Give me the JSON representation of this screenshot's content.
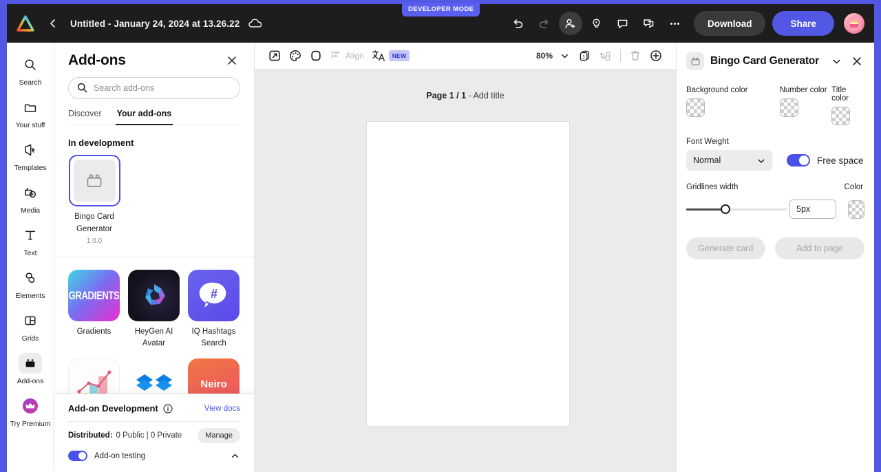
{
  "window": {
    "accent": "#5258e4"
  },
  "topbar": {
    "logo_icon": "adobe-express-logo",
    "back_icon": "chevron-left-icon",
    "document_title": "Untitled - January 24, 2024 at 13.26.22",
    "cloud_icon": "cloud-saved-icon",
    "dev_badge": "DEVELOPER MODE",
    "undo_icon": "undo-icon",
    "redo_icon": "redo-icon",
    "invite_icon": "add-collaborator-icon",
    "ideas_icon": "lightbulb-icon",
    "comment_icon": "comment-icon",
    "duplicate_icon": "copy-icon",
    "more_icon": "more-options-icon",
    "download_label": "Download",
    "share_label": "Share",
    "avatar_icon": "user-avatar"
  },
  "rail": {
    "items": [
      {
        "label": "Search",
        "icon": "search-icon",
        "active": false
      },
      {
        "label": "Your stuff",
        "icon": "folder-icon",
        "active": false
      },
      {
        "label": "Templates",
        "icon": "templates-icon",
        "active": false
      },
      {
        "label": "Media",
        "icon": "media-icon",
        "active": false
      },
      {
        "label": "Text",
        "icon": "text-icon",
        "active": false
      },
      {
        "label": "Elements",
        "icon": "elements-icon",
        "active": false
      },
      {
        "label": "Grids",
        "icon": "grids-icon",
        "active": false
      },
      {
        "label": "Add-ons",
        "icon": "addons-icon",
        "active": true
      },
      {
        "label": "Try Premium",
        "icon": "crown-icon",
        "active": false
      }
    ]
  },
  "addons_panel": {
    "title": "Add-ons",
    "close_icon": "close-icon",
    "search": {
      "placeholder": "Search add-ons",
      "value": "",
      "icon": "search-icon"
    },
    "tabs": [
      {
        "label": "Discover",
        "active": false
      },
      {
        "label": "Your add-ons",
        "active": true
      }
    ],
    "in_development": {
      "section_title": "In development",
      "items": [
        {
          "name": "Bingo Card Generator",
          "version": "1.0.0",
          "icon": "addon-placeholder-icon",
          "selected": true
        }
      ]
    },
    "addons": [
      {
        "name": "Gradients",
        "thumb_text": "GRADIENTS",
        "thumb": "gradients"
      },
      {
        "name": "HeyGen AI Avatar",
        "thumb_text": "",
        "thumb": "heygen"
      },
      {
        "name": "IQ Hashtags Search",
        "thumb_text": "#",
        "thumb": "iq"
      },
      {
        "name": "",
        "thumb_text": "",
        "thumb": "chart"
      },
      {
        "name": "",
        "thumb_text": "",
        "thumb": "dropbox"
      },
      {
        "name": "",
        "thumb_text": "Neiro",
        "thumb": "neiro"
      }
    ]
  },
  "dev_bar": {
    "title": "Add-on Development",
    "info_icon": "info-icon",
    "view_docs_label": "View docs",
    "distributed_label": "Distributed:",
    "distributed_value": "0 Public | 0 Private",
    "manage_label": "Manage",
    "testing_label": "Add-on testing",
    "testing_on": true,
    "collapse_icon": "chevron-up-icon"
  },
  "canvas": {
    "toolbar": {
      "resize_icon": "resize-icon",
      "palette_icon": "color-palette-icon",
      "shape_icon": "rounded-square-icon",
      "align_icon": "align-icon",
      "align_label": "Align",
      "translate_icon": "translate-icon",
      "new_badge": "NEW",
      "zoom_value": "80%",
      "zoom_chevron_icon": "chevron-down-icon",
      "pages_icon": "pages-icon",
      "animate_icon": "animate-icon",
      "delete_icon": "trash-icon",
      "add_page_icon": "add-page-icon"
    },
    "page_label_bold": "Page 1 / 1",
    "page_label_rest": " - Add title"
  },
  "right_panel": {
    "icon": "addon-placeholder-icon",
    "title": "Bingo Card Generator",
    "collapse_icon": "chevron-down-icon",
    "close_icon": "close-icon",
    "colors": [
      {
        "label": "Background color",
        "value": ""
      },
      {
        "label": "Number color",
        "value": ""
      },
      {
        "label": "Title color",
        "value": ""
      }
    ],
    "font_weight": {
      "label": "Font Weight",
      "value": "Normal",
      "chevron_icon": "chevron-down-icon"
    },
    "free_space": {
      "label": "Free space",
      "on": true
    },
    "gridlines": {
      "label": "Gridlines width",
      "slider_percent": 37,
      "value": "5px",
      "color_label": "Color"
    },
    "buttons": [
      {
        "label": "Generate card",
        "disabled": true
      },
      {
        "label": "Add to page",
        "disabled": true
      }
    ]
  }
}
